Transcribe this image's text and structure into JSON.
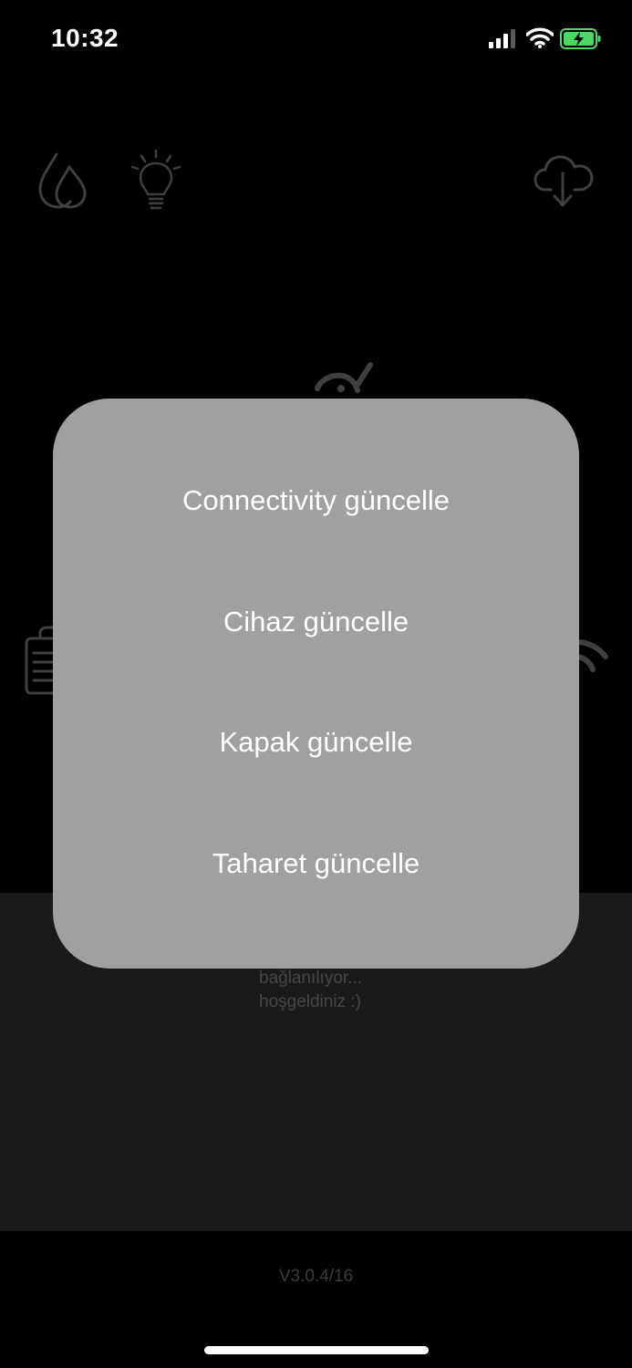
{
  "status_bar": {
    "time": "10:32"
  },
  "icons": {
    "drop": "water-drop-icon",
    "bulb": "light-bulb-icon",
    "cloud": "cloud-download-icon",
    "device": "device-icon",
    "clipboard": "clipboard-icon",
    "wifi": "wifi-icon"
  },
  "modal": {
    "items": [
      {
        "label": "Connectivity güncelle"
      },
      {
        "label": "Cihaz güncelle"
      },
      {
        "label": "Kapak güncelle"
      },
      {
        "label": "Taharet güncelle"
      }
    ]
  },
  "log": {
    "lines": [
      "bağlanılıyor...",
      "hoşgeldiniz :)"
    ]
  },
  "footer": {
    "version": "V3.0.4/16"
  },
  "colors": {
    "background": "#000000",
    "modal": "#a0a0a0",
    "log_panel": "#1a1a1a",
    "icon_dim": "#3a3a3a",
    "battery_green": "#4cd964"
  }
}
